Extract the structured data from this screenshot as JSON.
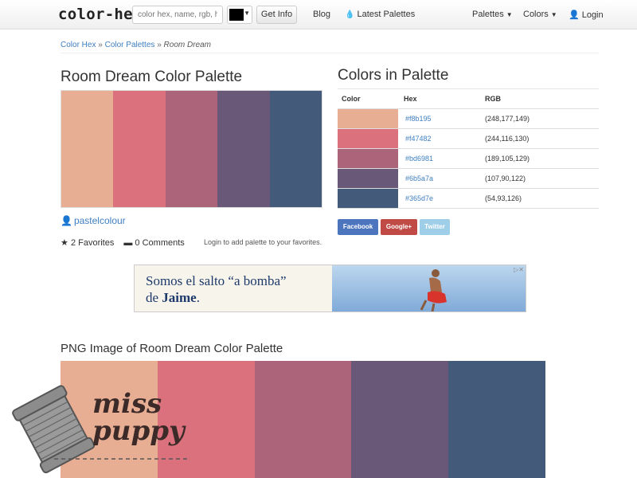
{
  "nav": {
    "brand": "color-hex",
    "search_placeholder": "color hex, name, rgb, hs",
    "swatch_color": "#000000",
    "get_info": "Get Info",
    "blog": "Blog",
    "latest": "Latest Palettes",
    "palettes": "Palettes",
    "colors": "Colors",
    "login": "Login"
  },
  "breadcrumb": {
    "home": "Color Hex",
    "sep1": "»",
    "palettes": "Color Palettes",
    "sep2": "»",
    "current": "Room Dream"
  },
  "palette": {
    "title": "Room Dream Color Palette",
    "author": "pastelcolour",
    "favorites": "2 Favorites",
    "comments": "0 Comments",
    "login_note": "Login to add palette to your favorites."
  },
  "colors_section": {
    "title": "Colors in Palette",
    "headers": {
      "color": "Color",
      "hex": "Hex",
      "rgb": "RGB"
    },
    "rows": [
      {
        "hex": "#f8b195",
        "rgb": "(248,177,149)"
      },
      {
        "hex": "#f47482",
        "rgb": "(244,116,130)"
      },
      {
        "hex": "#bd6981",
        "rgb": "(189,105,129)"
      },
      {
        "hex": "#6b5a7a",
        "rgb": "(107,90,122)"
      },
      {
        "hex": "#365d7e",
        "rgb": "(54,93,126)"
      }
    ]
  },
  "share": {
    "facebook": "Facebook",
    "google": "Google+",
    "twitter": "Twitter"
  },
  "ad": {
    "line1": "Somos el salto “a bomba”",
    "line2_pre": "de ",
    "line2_name": "Jaime",
    "line2_post": "."
  },
  "png_section": {
    "title": "PNG Image of Room Dream Color Palette"
  },
  "watermark": {
    "line1": "miss",
    "line2": "puppy"
  },
  "display_colors": [
    "#e8ae93",
    "#db717c",
    "#ab647a",
    "#6a5879",
    "#445a7a"
  ],
  "accent": "#3f7fc1",
  "share_colors": {
    "facebook": "#4d75be",
    "google": "#c04a45",
    "twitter": "#9fcfe8"
  }
}
